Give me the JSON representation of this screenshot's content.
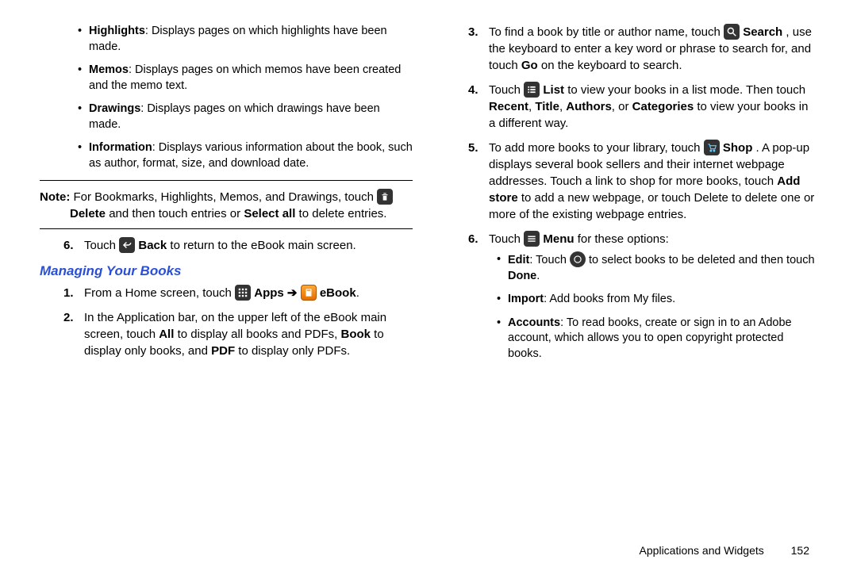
{
  "left": {
    "bullets": [
      {
        "term": "Highlights",
        "desc": ": Displays pages on which highlights have been made."
      },
      {
        "term": "Memos",
        "desc": ": Displays pages on which memos have been created and the memo text."
      },
      {
        "term": "Drawings",
        "desc": ": Displays pages on which drawings have been made."
      },
      {
        "term": "Information",
        "desc": ": Displays various information about the book, such as author, format, size, and download date."
      }
    ],
    "note": {
      "label": "Note:",
      "pre": "For Bookmarks, Highlights, Memos, and Drawings, touch ",
      "delete": "Delete",
      "mid": " and then touch entries or ",
      "selectall": "Select all",
      "post": " to delete entries."
    },
    "step6": {
      "num": "6.",
      "pre": "Touch ",
      "back": "Back",
      "post": " to return to the eBook main screen."
    },
    "heading": "Managing Your Books",
    "managing": {
      "s1": {
        "num": "1.",
        "pre": "From a Home screen, touch ",
        "apps": "Apps",
        "arrow": " ➔ ",
        "ebook": "eBook",
        "post": "."
      },
      "s2": {
        "num": "2.",
        "pre": "In the Application bar, on the upper left of the eBook main screen, touch ",
        "all": "All",
        "mid1": " to display all books and PDFs, ",
        "book": "Book",
        "mid2": " to display only books, and ",
        "pdf": "PDF",
        "post": " to display only PDFs."
      }
    }
  },
  "right": {
    "s3": {
      "num": "3.",
      "pre": "To find a book by title or author name, touch ",
      "search": "Search",
      "mid": ", use the keyboard to enter a key word or phrase to search for, and touch ",
      "go": "Go",
      "post": " on the keyboard to search."
    },
    "s4": {
      "num": "4.",
      "pre": "Touch ",
      "list": "List",
      "mid": " to view your books in a list mode. Then touch ",
      "recent": "Recent",
      "c1": ", ",
      "title": "Title",
      "c2": ", ",
      "authors": "Authors",
      "c3": ", or ",
      "categories": "Categories",
      "post": " to view your books in a different way."
    },
    "s5": {
      "num": "5.",
      "pre": "To add more books to your library, touch ",
      "shop": "Shop",
      "mid": ". A pop-up displays several book sellers and their internet webpage addresses. Touch a link to shop for more books, touch ",
      "addstore": "Add store",
      "post": " to add a new webpage, or touch Delete to delete one or more of the existing webpage entries."
    },
    "s6": {
      "num": "6.",
      "pre": "Touch ",
      "menu": "Menu",
      "post": " for these options:"
    },
    "s6bullets": [
      {
        "term": "Edit",
        "pre": ": Touch ",
        "post": " to select books to be deleted and then touch ",
        "done": "Done",
        "end": "."
      },
      {
        "term": "Import",
        "desc": ": Add books from My files."
      },
      {
        "term": "Accounts",
        "desc": ": To read books, create or sign in to an Adobe account, which allows you to open copyright protected books."
      }
    ]
  },
  "footer": {
    "section": "Applications and Widgets",
    "page": "152"
  }
}
